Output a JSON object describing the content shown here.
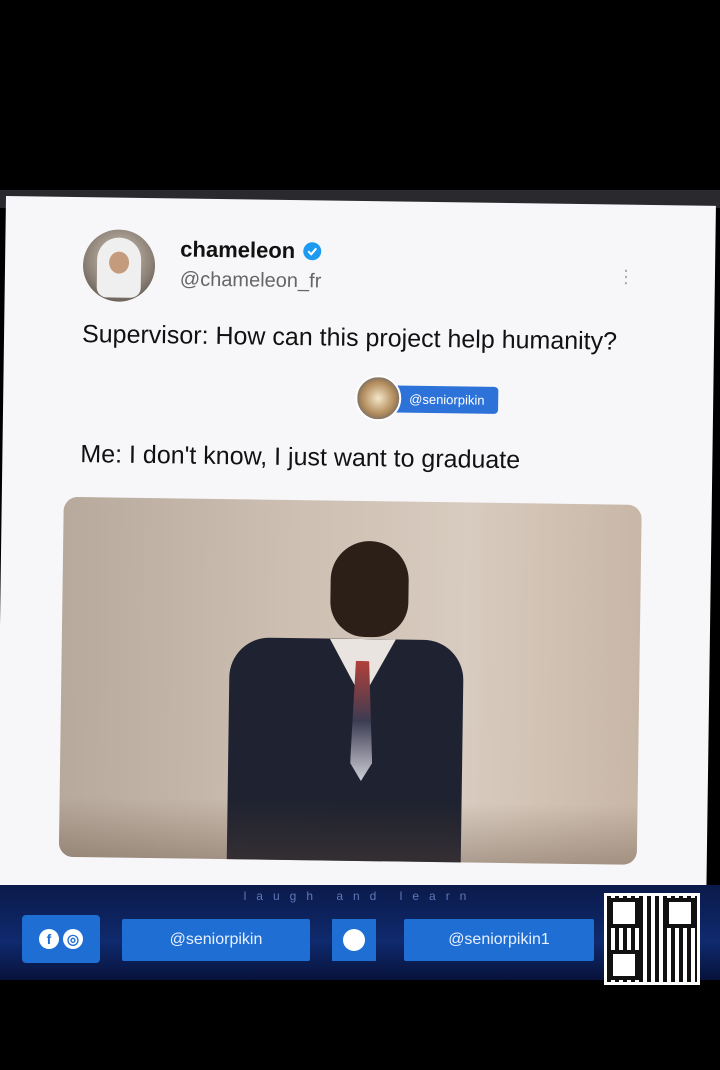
{
  "tweet": {
    "display_name": "chameleon",
    "handle": "@chameleon_fr",
    "line1": "Supervisor: How can this project help humanity?",
    "line2": "Me: I don't know, I just want to graduate"
  },
  "watermark": {
    "label": "@seniorpikin"
  },
  "footer": {
    "tagline": "laugh and learn",
    "handle_left": "@seniorpikin",
    "handle_right": "@seniorpikin1"
  },
  "colors": {
    "verified": "#1d9bf0",
    "footer_bg": "#0f2a6e",
    "footer_box": "#1f6ed4"
  },
  "icons": {
    "verified": "verified-badge-icon",
    "social": "facebook-instagram-icon",
    "twitter": "twitter-icon",
    "more": "more-options-icon"
  }
}
